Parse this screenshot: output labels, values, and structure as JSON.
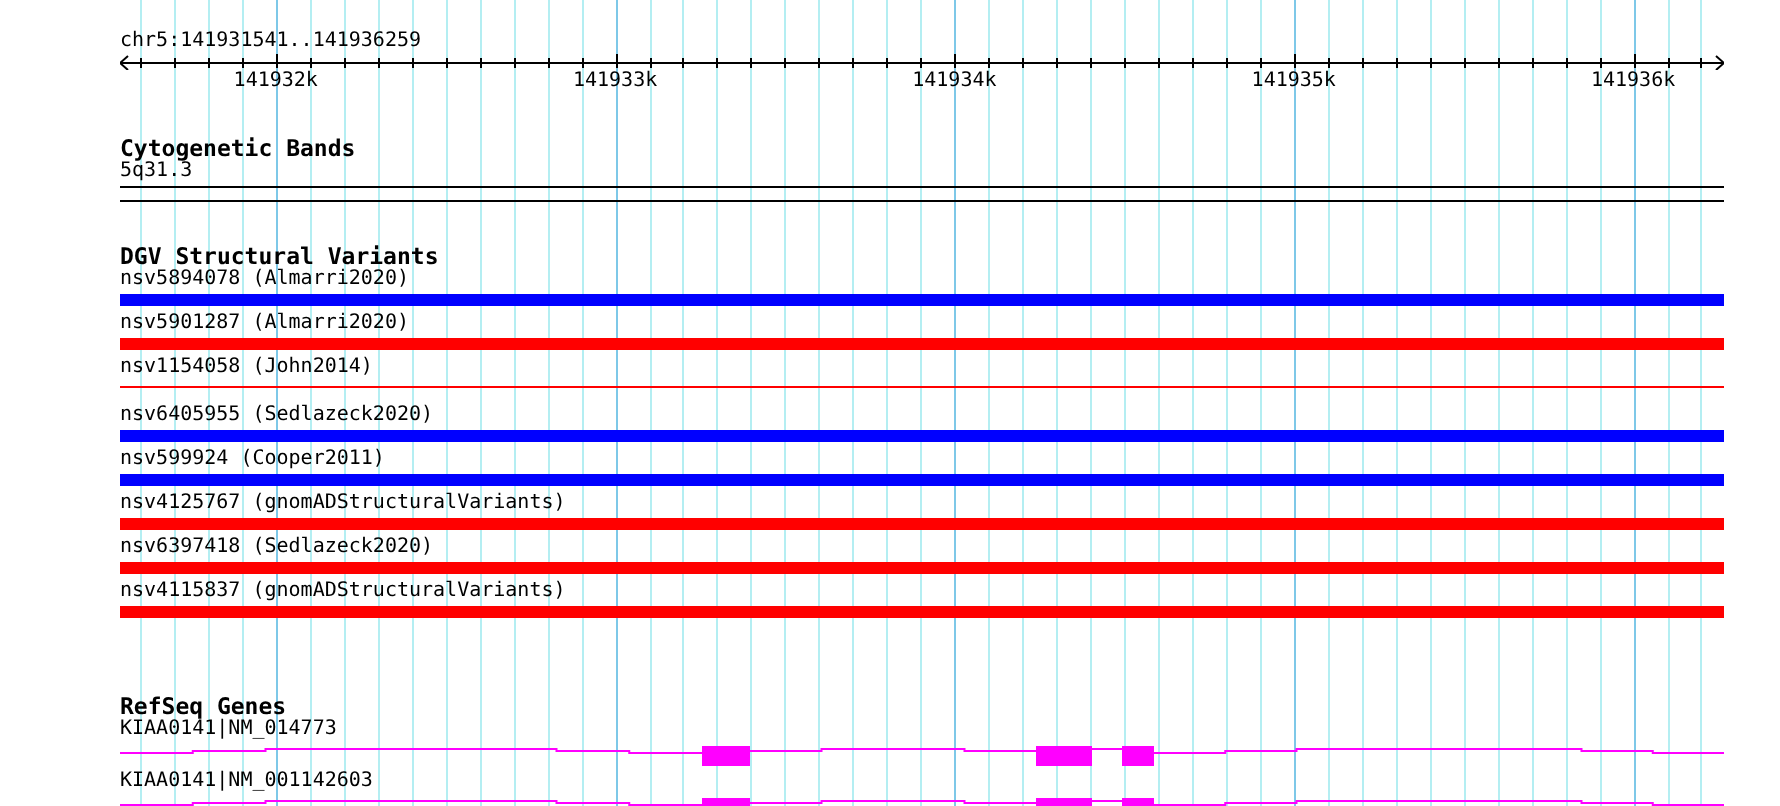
{
  "ruler": {
    "location": "chr5:141931541..141936259",
    "ticks": [
      "141932k",
      "141933k",
      "141934k",
      "141935k",
      "141936k"
    ]
  },
  "cytogenetic_bands": {
    "title": "Cytogenetic Bands",
    "band": "5q31.3"
  },
  "dgv_structural_variants": {
    "title": "DGV Structural Variants",
    "items": [
      {
        "label": "nsv5894078 (Almarri2020)",
        "color": "#0000ff",
        "kind": "bar"
      },
      {
        "label": "nsv5901287 (Almarri2020)",
        "color": "#ff0000",
        "kind": "bar"
      },
      {
        "label": "nsv1154058 (John2014)",
        "color": "#ff0000",
        "kind": "line"
      },
      {
        "label": "nsv6405955 (Sedlazeck2020)",
        "color": "#0000ff",
        "kind": "bar"
      },
      {
        "label": "nsv599924 (Cooper2011)",
        "color": "#0000ff",
        "kind": "bar"
      },
      {
        "label": "nsv4125767 (gnomADStructuralVariants)",
        "color": "#ff0000",
        "kind": "bar"
      },
      {
        "label": "nsv6397418 (Sedlazeck2020)",
        "color": "#ff0000",
        "kind": "bar"
      },
      {
        "label": "nsv4115837 (gnomADStructuralVariants)",
        "color": "#ff0000",
        "kind": "bar"
      }
    ]
  },
  "refseq_genes": {
    "title": "RefSeq Genes",
    "items": [
      {
        "label": "KIAA0141|NM_014773"
      },
      {
        "label": "KIAA0141|NM_001142603"
      }
    ]
  }
}
